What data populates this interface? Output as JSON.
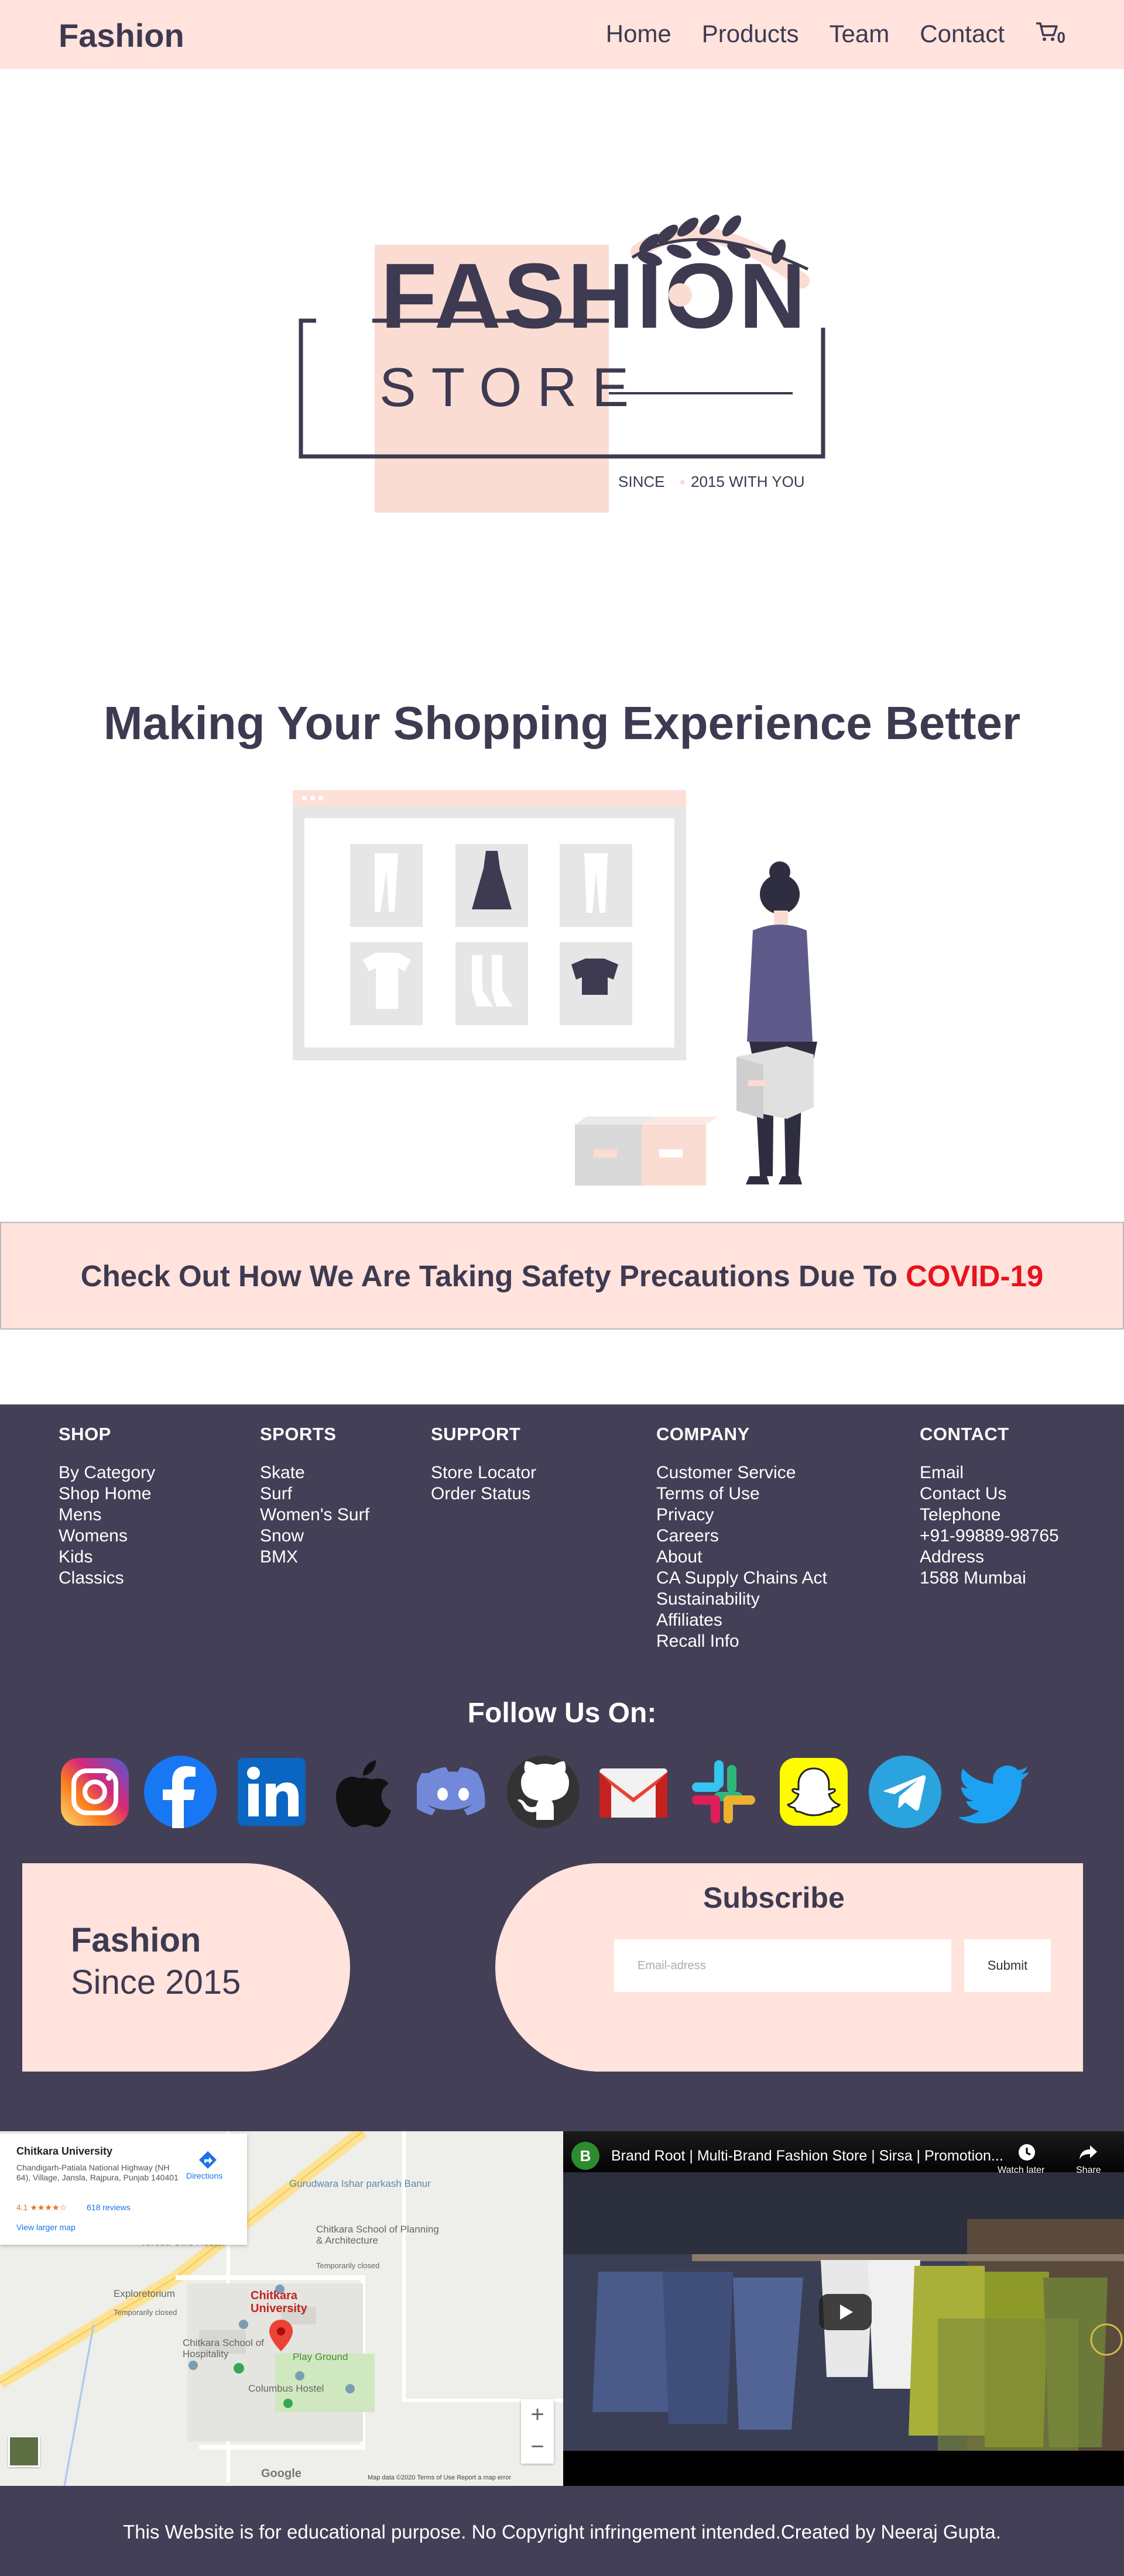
{
  "nav": {
    "brand": "Fashion",
    "links": [
      "Home",
      "Products",
      "Team",
      "Contact"
    ],
    "cart_count": "0"
  },
  "logo": {
    "line1": "FASHION",
    "line2": "STORE",
    "tagline_a": "SINCE",
    "tagline_b": "2015 WITH YOU"
  },
  "headline": "Making Your Shopping Experience Better",
  "covid": {
    "text": "Check Out How We Are Taking Safety Precautions Due To",
    "highlight": "COVID-19",
    "highlight_color": "#e8131c"
  },
  "footer": {
    "columns": [
      {
        "title": "SHOP",
        "items": [
          "By Category",
          "Shop Home",
          "Mens",
          "Womens",
          "Kids",
          "Classics"
        ]
      },
      {
        "title": "SPORTS",
        "items": [
          "Skate",
          "Surf",
          "Women's Surf",
          "Snow",
          "BMX"
        ]
      },
      {
        "title": "SUPPORT",
        "items": [
          "Store Locator",
          "Order Status"
        ]
      },
      {
        "title": "COMPANY",
        "items": [
          "Customer Service",
          "Terms of Use",
          "Privacy",
          "Careers",
          "About",
          "CA Supply Chains Act",
          "Sustainability",
          "Affiliates",
          "Recall Info"
        ]
      },
      {
        "title": "CONTACT",
        "items": [
          "Email",
          "Contact Us",
          "Telephone",
          "+91-99889-98765",
          "Address",
          "1588 Mumbai"
        ]
      }
    ],
    "follow_title": "Follow Us On:",
    "socials": [
      "instagram-icon",
      "facebook-icon",
      "linkedin-icon",
      "apple-icon",
      "discord-icon",
      "github-icon",
      "gmail-icon",
      "slack-icon",
      "snapchat-icon",
      "telegram-icon",
      "twitter-icon"
    ],
    "brand_title": "Fashion",
    "brand_since": "Since 2015",
    "subscribe_title": "Subscribe",
    "email_placeholder": "Email-adress",
    "submit_label": "Submit"
  },
  "map": {
    "place_name": "Chitkara University",
    "address": "Chandigarh-Patiala National Highway (NH 64), Village, Jansla, Rajpura, Punjab 140401",
    "rating": "4.1 ★★★★☆",
    "reviews": "618 reviews",
    "larger_map": "View larger map",
    "directions": "Directions",
    "labels": {
      "gurudwara": "Gurudwara Ishar parkash Banur",
      "teresa": "Teresa Girls Hostel",
      "school_planning": "Chitkara School of Planning & Architecture",
      "temp_closed": "Temporarily closed",
      "exploretorium": "Exploretorium",
      "temp_closed2": "Temporarily closed",
      "university": "Chitkara University",
      "school_hospitality": "Chitkara School of Hospitality",
      "play_ground": "Play Ground",
      "columbus": "Columbus Hostel"
    },
    "zoom_in": "+",
    "zoom_out": "−",
    "google": "Google",
    "map_data": "Map data ©2020   Terms of Use   Report a map error"
  },
  "video": {
    "channel_initial": "B",
    "title": "Brand Root | Multi-Brand Fashion Store | Sirsa | Promotion...",
    "watch_later": "Watch later",
    "share": "Share"
  },
  "bottom_text": "This Website is for educational purpose. No Copyright infringement intended.Created by Neeraj Gupta.",
  "colors": {
    "peach": "#ffe3dc",
    "navy": "#433f56",
    "text": "#3d3a51"
  }
}
